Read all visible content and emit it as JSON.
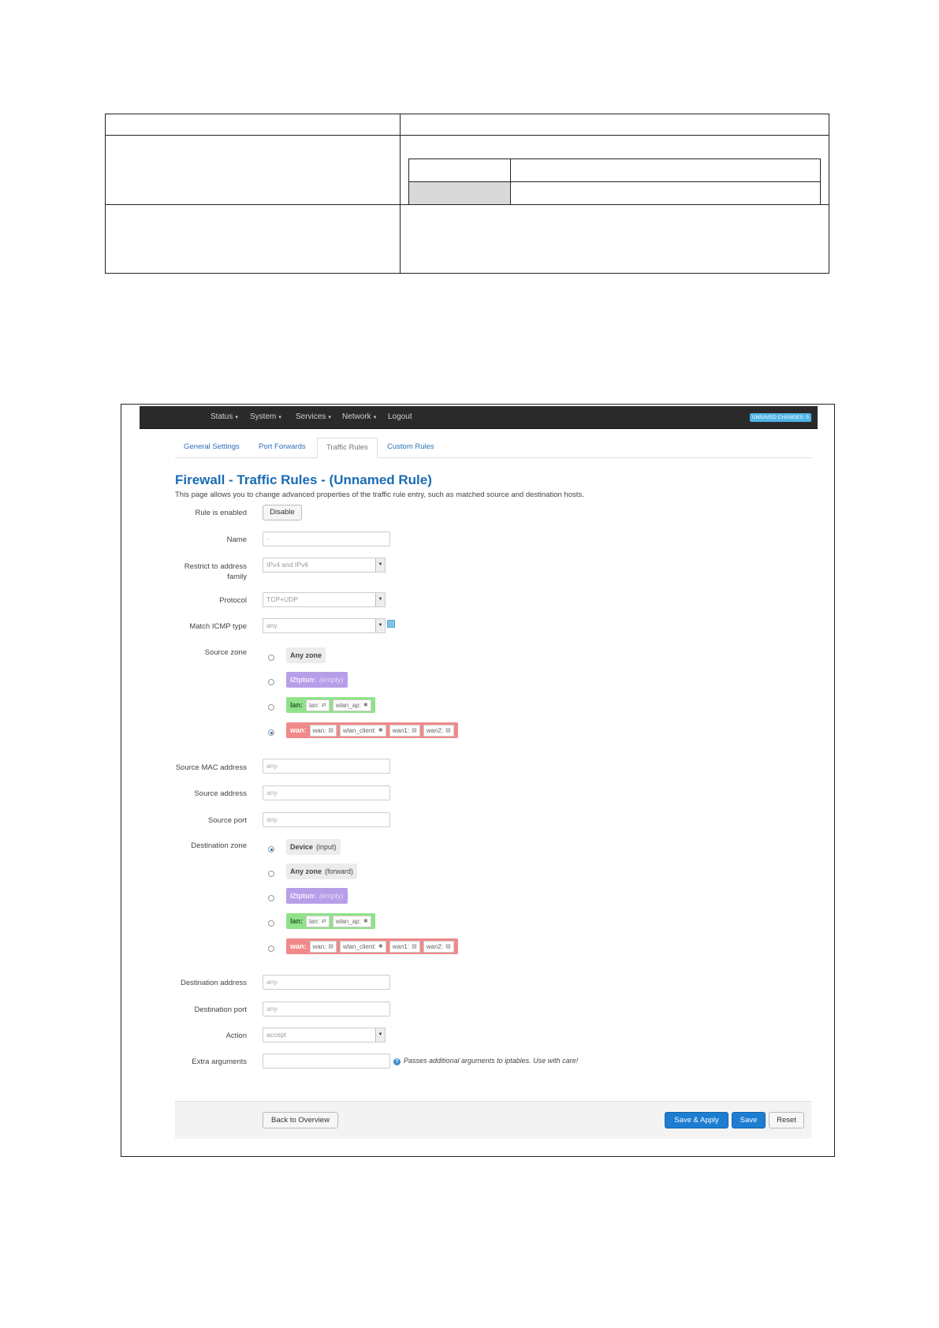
{
  "navbar": {
    "items": [
      "Status",
      "System",
      "Services",
      "Network",
      "Logout"
    ],
    "unsaved_badge": "UNSAVED CHANGES: 5"
  },
  "tabs": [
    {
      "label": "General Settings"
    },
    {
      "label": "Port Forwards"
    },
    {
      "label": "Traffic Rules"
    },
    {
      "label": "Custom Rules"
    }
  ],
  "page": {
    "title": "Firewall - Traffic Rules - (Unnamed Rule)",
    "description": "This page allows you to change advanced properties of the traffic rule entry, such as matched source and destination hosts."
  },
  "form": {
    "rule_enabled_label": "Rule is enabled",
    "disable_button": "Disable",
    "name_label": "Name",
    "name_value": "-",
    "family_label_1": "Restrict to address",
    "family_label_2": "family",
    "family_value": "IPv4 and IPv6",
    "protocol_label": "Protocol",
    "protocol_value": "TCP+UDP",
    "icmp_label": "Match ICMP type",
    "icmp_value": "any",
    "source_zone_label": "Source zone",
    "src_mac_label": "Source MAC address",
    "src_mac_placeholder": "any",
    "src_addr_label": "Source address",
    "src_addr_placeholder": "any",
    "src_port_label": "Source port",
    "src_port_placeholder": "any",
    "dest_zone_label": "Destination zone",
    "dest_addr_label": "Destination address",
    "dest_addr_placeholder": "any",
    "dest_port_label": "Destination port",
    "dest_port_placeholder": "any",
    "action_label": "Action",
    "action_value": "accept",
    "extra_label": "Extra arguments",
    "extra_help": "Passes additional arguments to iptables. Use with care!"
  },
  "zones": {
    "any_zone": "Any zone",
    "any_zone_forward": "(forward)",
    "device": "Device",
    "device_input": "(input)",
    "l2tptun": "l2tptun:",
    "empty": "(empty)",
    "lan": "lan:",
    "lan_chips": [
      "lan:",
      "wlan_ap:"
    ],
    "wan": "wan:",
    "wan_chips": [
      "wan:",
      "wlan_client:",
      "wan1:",
      "wan2:"
    ],
    "source_selected": "wan",
    "dest_selected": "device"
  },
  "footer": {
    "back": "Back to Overview",
    "save_apply": "Save & Apply",
    "save": "Save",
    "reset": "Reset"
  },
  "colors": {
    "title_blue": "#1a6cb4",
    "zone_purple": "#b89ee8",
    "zone_green": "#90e28a",
    "zone_red": "#f08a8a",
    "button_blue": "#1d7dd1"
  }
}
